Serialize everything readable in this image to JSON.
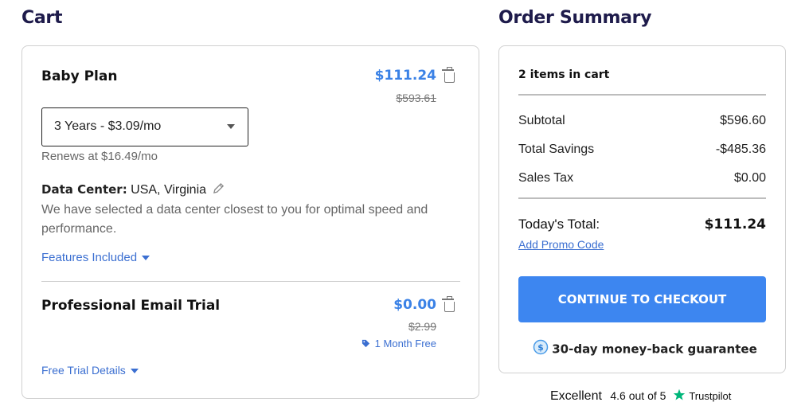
{
  "cart": {
    "title": "Cart",
    "items": [
      {
        "name": "Baby Plan",
        "price": "$111.24",
        "original_price": "$593.61",
        "term_select": {
          "selected": "3 Years - $3.09/mo"
        },
        "renews": "Renews at $16.49/mo",
        "data_center_label": "Data Center:",
        "data_center_value": "USA, Virginia",
        "data_center_note": "We have selected a data center closest to you for optimal speed and performance.",
        "features_link": "Features Included"
      },
      {
        "name": "Professional Email Trial",
        "price": "$0.00",
        "original_price": "$2.99",
        "tag": "1 Month Free",
        "details_link": "Free Trial Details"
      }
    ]
  },
  "summary": {
    "title": "Order Summary",
    "items_count": "2 items in cart",
    "rows": [
      {
        "label": "Subtotal",
        "value": "$596.60"
      },
      {
        "label": "Total Savings",
        "value": "-$485.36"
      },
      {
        "label": "Sales Tax",
        "value": "$0.00"
      }
    ],
    "total_label": "Today's Total:",
    "total_value": "$111.24",
    "promo_link": "Add Promo Code",
    "checkout_button": "CONTINUE TO CHECKOUT",
    "guarantee": "30-day money-back guarantee"
  },
  "trustpilot": {
    "rating_word": "Excellent",
    "score": "4.6 out of 5",
    "brand": "Trustpilot"
  },
  "colors": {
    "accent": "#3d86f0",
    "heading": "#1e1b4b",
    "trustpilot_green": "#00b67a"
  },
  "icons": [
    "trash-icon",
    "pencil-icon",
    "caret-down-icon",
    "tag-icon",
    "dollar-shield-icon",
    "star-icon"
  ]
}
